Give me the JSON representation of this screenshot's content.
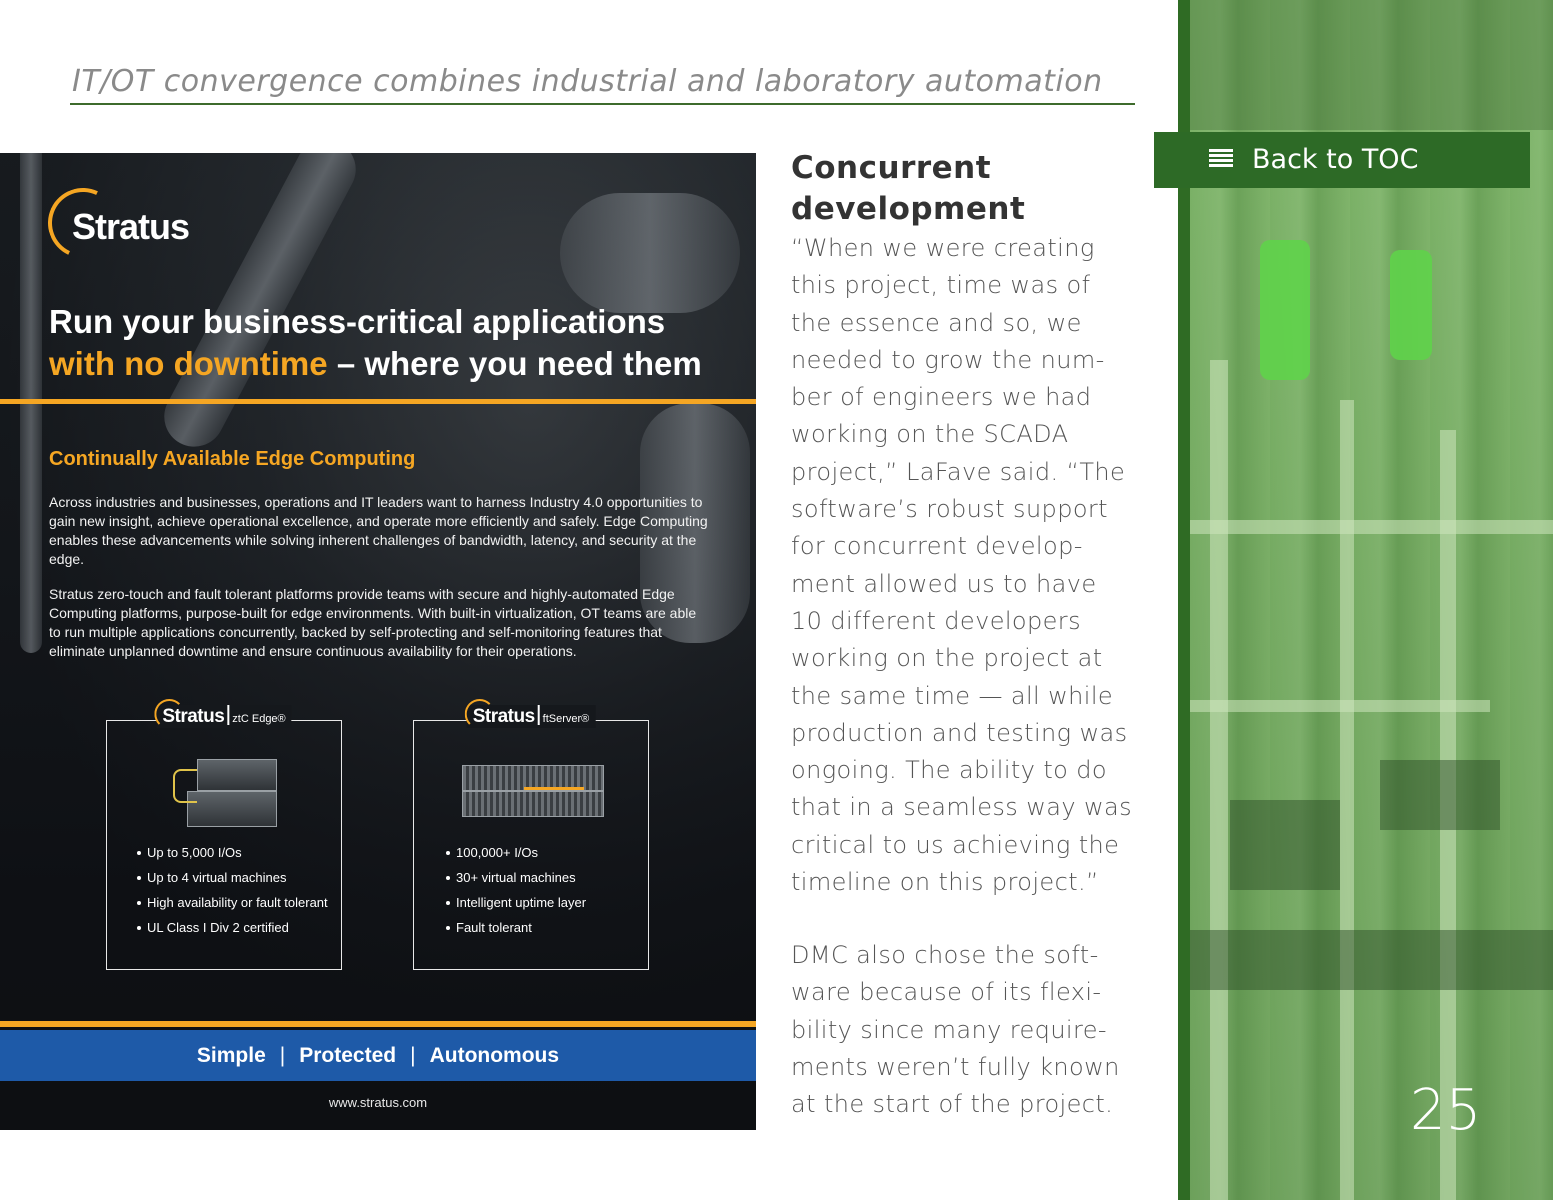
{
  "header": {
    "title": "IT/OT convergence combines industrial and laboratory automation"
  },
  "ad": {
    "logo": "Stratus",
    "headline_part1": "Run your business-critical applications",
    "headline_accent": "with no downtime",
    "headline_part2": "– where you need them",
    "subheading": "Continually Available Edge Computing",
    "paragraph1": "Across industries and businesses, operations and IT leaders want to harness Industry 4.0 opportunities to gain new insight, achieve operational excellence, and operate more efficiently and safely. Edge Computing enables these advancements while solving inherent challenges of bandwidth, latency, and security at the edge.",
    "paragraph2": "Stratus zero-touch and fault tolerant platforms provide teams with secure and highly-automated Edge Computing platforms, purpose-built for edge environments. With built-in virtualization, OT teams are able to run multiple applications concurrently, backed by self-protecting and self-monitoring features that eliminate unplanned downtime and ensure continuous availability for their operations.",
    "products": [
      {
        "brand": "Stratus",
        "model": "ztC Edge®",
        "features": [
          "Up to 5,000 I/Os",
          "Up to 4 virtual machines",
          "High availability or fault tolerant",
          "UL Class I Div 2 certified"
        ]
      },
      {
        "brand": "Stratus",
        "model": "ftServer®",
        "features": [
          "100,000+ I/Os",
          "30+ virtual machines",
          "Intelligent uptime layer",
          "Fault tolerant"
        ]
      }
    ],
    "taglines": [
      "Simple",
      "Protected",
      "Autonomous"
    ],
    "separator": "|",
    "url": "www.stratus.com",
    "colors": {
      "accent": "#f5a623",
      "band": "#1e5aa8"
    }
  },
  "article": {
    "title_lines": [
      "Concurrent",
      "development"
    ],
    "paragraph1_lines": [
      "“When we were creating",
      "this project, time was of",
      "the essence and so, we",
      "needed to grow the num-",
      "ber of engineers we had",
      "working on the SCADA",
      "project,” LaFave said. “The",
      "software’s robust support",
      "for concurrent develop-",
      "ment allowed us to have",
      "10 different developers",
      "working on the project at",
      "the same time — all while",
      "production and testing was",
      "ongoing. The ability to do",
      "that in a seamless way was",
      "critical to us achieving the",
      "timeline on this project.”"
    ],
    "paragraph2_lines": [
      "DMC also chose the soft-",
      "ware because of its flexi-",
      "bility since many require-",
      "ments weren’t fully known",
      "at the start of the project."
    ]
  },
  "sidebar": {
    "toc_label": "Back to TOC",
    "toc_icon": "list-icon",
    "page_number": "25",
    "color": "#2d6a26"
  }
}
